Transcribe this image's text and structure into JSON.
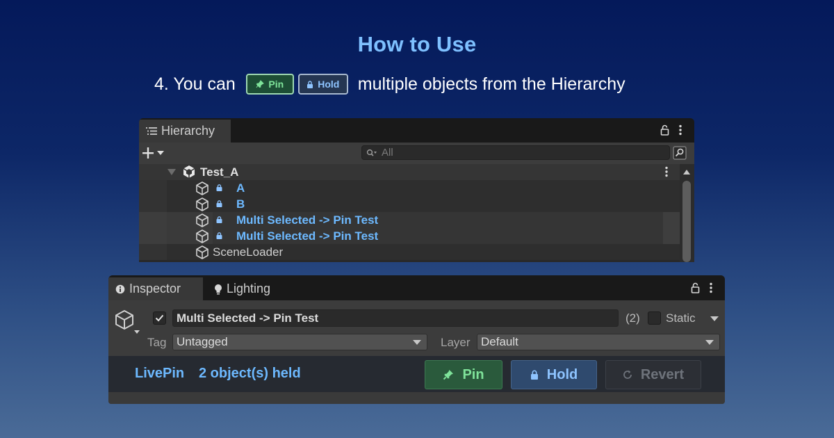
{
  "heading": "How to Use",
  "step": {
    "prefix": "4. You can",
    "pin_chip": "Pin",
    "hold_chip": "Hold",
    "suffix": "multiple objects from the Hierarchy"
  },
  "hierarchy": {
    "tab_label": "Hierarchy",
    "search_placeholder": "All",
    "scene_name": "Test_A",
    "rows": [
      {
        "label": "A",
        "locked": true,
        "selected": false
      },
      {
        "label": "B",
        "locked": true,
        "selected": false
      },
      {
        "label": "Multi Selected -> Pin Test",
        "locked": true,
        "selected": true
      },
      {
        "label": "Multi Selected -> Pin Test",
        "locked": true,
        "selected": true
      },
      {
        "label": "SceneLoader",
        "locked": false,
        "selected": false
      }
    ],
    "icons": [
      "list-icon",
      "lock-icon",
      "kebab-icon",
      "plus-icon",
      "search-icon",
      "search-mode-icon",
      "unity-scene-icon",
      "cube-icon"
    ]
  },
  "inspector": {
    "tabs": [
      {
        "label": "Inspector",
        "icon": "info-icon",
        "active": true
      },
      {
        "label": "Lighting",
        "icon": "bulb-icon",
        "active": false
      }
    ],
    "object_name": "Multi Selected -> Pin Test",
    "active_checked": true,
    "selection_count": "(2)",
    "static_label": "Static",
    "tag_label": "Tag",
    "tag_value": "Untagged",
    "layer_label": "Layer",
    "layer_value": "Default"
  },
  "livepin": {
    "title": "LivePin",
    "status": "2 object(s) held",
    "pin_button": "Pin",
    "hold_button": "Hold",
    "revert_button": "Revert"
  },
  "colors": {
    "accent_blue": "#6db9ff",
    "pin_green": "#7fe39a",
    "hold_blue": "#8ec4ff"
  }
}
